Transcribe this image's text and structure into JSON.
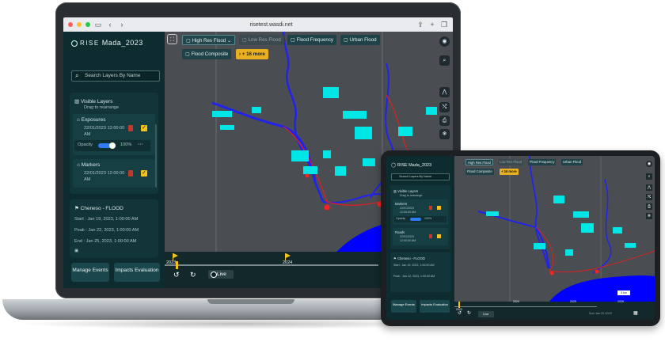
{
  "browser": {
    "url": "risetest.wasdi.net"
  },
  "app": {
    "title": "Mada_2023",
    "search_placeholder": "Search Layers By Name",
    "layers_panel": {
      "title": "Visible Layers",
      "subtitle": "Drag to rearrange",
      "layers": [
        {
          "name": "Exposures",
          "date": "22/01/2023 12:00:00 AM"
        },
        {
          "name": "Markers",
          "date": "22/01/2023 12:00:00 AM"
        }
      ],
      "opacity_label": "Opacity",
      "opacity_value": "100%"
    },
    "event": {
      "title": "Cheneso - FLOOD",
      "start": "Start : Jan 19, 2023, 1:00:00 AM",
      "peak": "Peak : Jan 22, 2023, 1:00:00 AM",
      "end": "End : Jan 25, 2023, 1:00:00 AM"
    },
    "buttons": {
      "manage": "Manage Events",
      "impacts": "Impacts Evaluation"
    },
    "map_chips": [
      "High Res Flood",
      "Low Res Flood",
      "Flood Frequency",
      "Urban Flood",
      "Flood Composite",
      "+ 16 more"
    ],
    "timeline": {
      "years": [
        "2023",
        "2024"
      ],
      "live": "Live"
    }
  },
  "tablet": {
    "title": "Mada_2023",
    "search_placeholder": "Search Layers By Name",
    "panel_title": "Visible Layers",
    "panel_subtitle": "Drag to rearrange",
    "layers": [
      {
        "name": "Markers",
        "date": "22/01/2023 12:00:00 AM"
      },
      {
        "name": "Roads",
        "date": "22/01/2023 12:00:00 AM"
      }
    ],
    "opacity_label": "Opacity",
    "opacity_value": "100%",
    "event": {
      "title": "Cheneso - FLOOD",
      "start": "Start : Jan 19, 2023, 1:00:00 AM",
      "peak": "Peak : Jan 22, 2023, 1:00:00 AM"
    },
    "buttons": {
      "manage": "Manage Events",
      "impacts": "Impacts Evaluation"
    },
    "map_chips": [
      "High Res Flood",
      "Low Res Flood",
      "Flood Frequency",
      "Urban Flood",
      "Flood Composite",
      "+ 16 more"
    ],
    "timeline": {
      "years": [
        "2023",
        "2024",
        "2025",
        "2026"
      ],
      "live": "Live",
      "date": "Sun Jan 22 2023"
    },
    "scale": "5 km"
  },
  "colors": {
    "sidebar": "#0e2c30",
    "accent": "#e8b020",
    "flood": "#00e5e5",
    "sea": "#0000ff",
    "land": "#4a4d52"
  }
}
